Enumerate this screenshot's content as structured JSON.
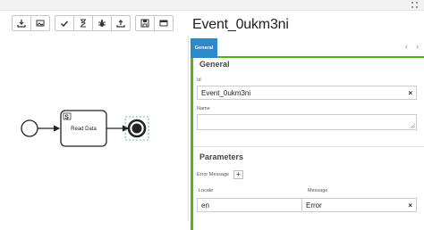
{
  "toolbar": {
    "groups": [
      [
        {
          "icon": "download-icon"
        },
        {
          "icon": "image-icon"
        }
      ],
      [
        {
          "icon": "check-icon"
        },
        {
          "icon": "hourglass-icon"
        },
        {
          "icon": "bug-icon"
        },
        {
          "icon": "upload-icon"
        }
      ],
      [
        {
          "icon": "save-icon"
        },
        {
          "icon": "window-icon"
        }
      ]
    ]
  },
  "diagram": {
    "task_label": "Read Data",
    "task_marker": "S"
  },
  "panel": {
    "title": "Event_0ukm3ni",
    "tabs": [
      {
        "label": "General",
        "active": true
      }
    ],
    "nav_prev": "‹",
    "nav_next": "›",
    "general": {
      "heading": "General",
      "id_label": "Id",
      "id_value": "Event_0ukm3ni",
      "name_label": "Name",
      "name_value": ""
    },
    "parameters": {
      "heading": "Parameters",
      "error_message_label": "Error Message",
      "add_label": "+",
      "columns": [
        "Locale",
        "Message"
      ],
      "rows": [
        {
          "locale": "en",
          "message": "Error"
        }
      ]
    },
    "clear_symbol": "×"
  },
  "colors": {
    "accent_green": "#52B415",
    "tab_blue": "#2b8aca",
    "selection": "#4a90d9"
  }
}
